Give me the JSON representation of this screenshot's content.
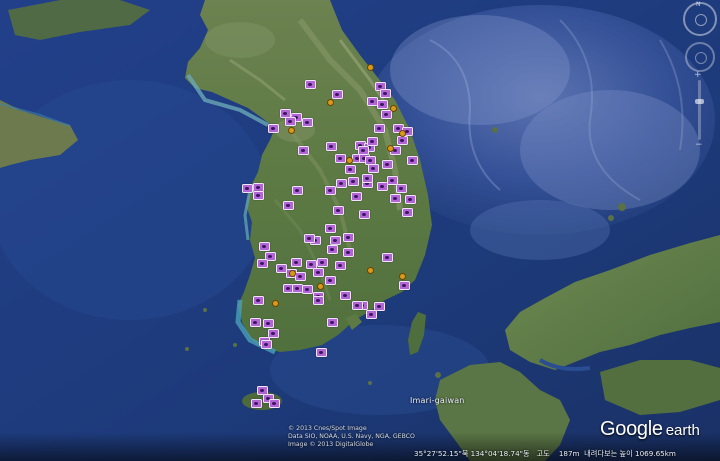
{
  "map": {
    "place_label": "Imari-gaiwan",
    "credits": [
      "© 2013 Cnes/Spot Image",
      "Data SIO, NOAA, U.S. Navy, NGA, GEBCO",
      "Image © 2013 DigitalGlobe"
    ],
    "brand_google": "Google",
    "brand_earth": "earth",
    "status": {
      "coordinates": "35°27'52.15\"북 134°04'18.74\"동",
      "elevation_label": "고도",
      "elevation_value": "187m",
      "eye_altitude_label": "내려다보는 높이",
      "eye_altitude_value": "1069.65km"
    },
    "navigation": {
      "north_label": "N",
      "zoom_level": 0.35,
      "zoom_in_icon": "plus-icon",
      "zoom_out_icon": "minus-icon"
    },
    "photo_marker_count": 93,
    "place_pin_count": 12,
    "colors": {
      "ocean": "#1e3a78",
      "land": "#5f7a45",
      "photo_marker": "#b266d6",
      "place_pin": "#d89a1a"
    }
  }
}
